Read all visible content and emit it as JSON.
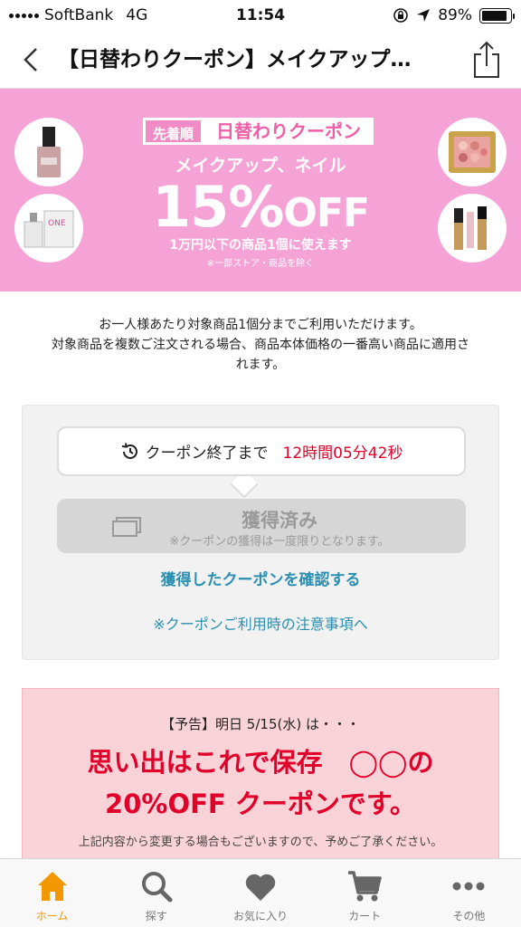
{
  "status_bar": {
    "carrier": "SoftBank",
    "network": "4G",
    "time": "11:54",
    "battery": "89%",
    "battery_level": 0.89
  },
  "nav": {
    "title": "【日替わりクーポン】メイクアップ…",
    "back_icon": "chevron-left-icon",
    "share_icon": "share-icon"
  },
  "banner": {
    "badge_first": "先着順",
    "badge_main": "日替わりクーポン",
    "subtitle": "メイクアップ、ネイル",
    "discount": "15%",
    "off": "OFF",
    "condition": "1万円以下の商品1個に使えます",
    "note": "※一部ストア・商品を除く",
    "colors": {
      "background": "#f5a3d6",
      "accent": "#ee5fa8"
    }
  },
  "description": {
    "line1": "お一人様あたり対象商品1個分までご利用いただけます。",
    "line2": "対象商品を複数ご注文される場合、商品本体価格の一番高い商品に適用さ",
    "line3": "れます。"
  },
  "coupon": {
    "timer_label": "クーポン終了まで",
    "timer_value": "12時間05分42秒",
    "acquired_label": "獲得済み",
    "acquired_sub": "※クーポンの獲得は一度限りとなります。",
    "confirm_link": "獲得したクーポンを確認する",
    "notes_link": "※クーポンご利用時の注意事項へ"
  },
  "announcement": {
    "date_line": "【予告】明日 5/15(水) は・・・",
    "line1": "思い出はこれで保存　◯◯の",
    "line2": "20%OFF クーポンです。",
    "note": "上記内容から変更する場合もございますので、予めご了承ください。"
  },
  "tabs": [
    {
      "label": "ホーム",
      "icon": "home-icon",
      "active": true
    },
    {
      "label": "探す",
      "icon": "search-icon",
      "active": false
    },
    {
      "label": "お気に入り",
      "icon": "heart-icon",
      "active": false
    },
    {
      "label": "カート",
      "icon": "cart-icon",
      "active": false
    },
    {
      "label": "その他",
      "icon": "more-icon",
      "active": false
    }
  ],
  "colors": {
    "link": "#2a8fb0",
    "alert_red": "#e0002a",
    "tab_active": "#f39800"
  }
}
